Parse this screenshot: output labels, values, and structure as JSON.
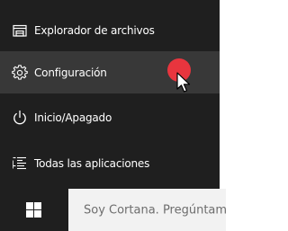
{
  "start_menu": {
    "items": [
      {
        "label": "Explorador de archivos",
        "icon": "file-explorer-icon"
      },
      {
        "label": "Configuración",
        "icon": "settings-gear-icon"
      },
      {
        "label": "Inicio/Apagado",
        "icon": "power-icon"
      },
      {
        "label": "Todas las aplicaciones",
        "icon": "all-apps-icon"
      }
    ]
  },
  "taskbar": {
    "search_text": "Soy Cortana. Pregúntame lo que quieras"
  },
  "overlay": {
    "click_indicator_color": "#e8353e",
    "pointer": "mouse-pointer-icon"
  }
}
